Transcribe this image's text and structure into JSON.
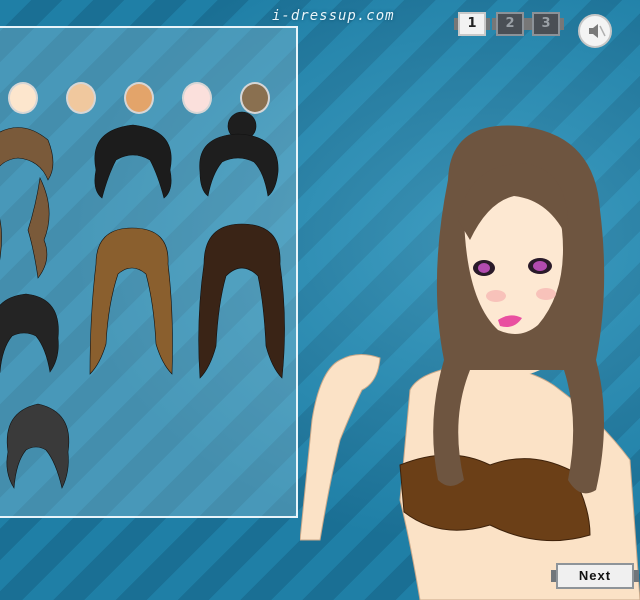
{
  "header": {
    "logo_text": "i-dressup.com",
    "pages": [
      {
        "label": "1",
        "active": true
      },
      {
        "label": "2",
        "active": false
      },
      {
        "label": "3",
        "active": false
      }
    ],
    "sound_icon": "speaker-icon"
  },
  "skin_tones": [
    "#fde6cd",
    "#f0c89e",
    "#e3a46a",
    "#fbe0dc",
    "#8a7050"
  ],
  "hair_styles": [
    {
      "name": "hair-brown-wavy",
      "color": "#7a5a3a"
    },
    {
      "name": "hair-black-bob",
      "color": "#1c1c1c"
    },
    {
      "name": "hair-black-bun",
      "color": "#1e1e1e"
    },
    {
      "name": "hair-light-brown-long",
      "color": "#8a5f2e"
    },
    {
      "name": "hair-dark-brown-long",
      "color": "#3a2416"
    },
    {
      "name": "hair-black-curly-updo",
      "color": "#242424"
    },
    {
      "name": "hair-black-gray-updo",
      "color": "#3a3a3a"
    }
  ],
  "footer": {
    "next_label": "Next"
  },
  "colors": {
    "bg_stripe_a": "#1f7fa6",
    "bg_stripe_b": "#1a6f94",
    "doll_hair": "#6e5540",
    "doll_top": "#6b3f17"
  }
}
